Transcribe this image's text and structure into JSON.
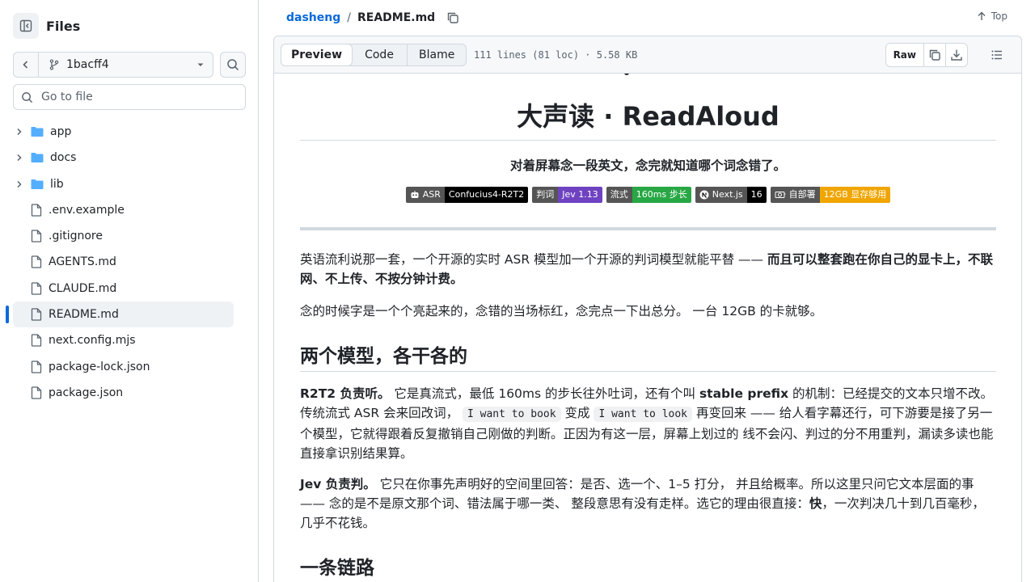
{
  "sidebar": {
    "title": "Files",
    "branch": "1bacff4",
    "goto_placeholder": "Go to file",
    "items": [
      {
        "name": "app",
        "type": "folder"
      },
      {
        "name": "docs",
        "type": "folder"
      },
      {
        "name": "lib",
        "type": "folder"
      },
      {
        "name": ".env.example",
        "type": "file"
      },
      {
        "name": ".gitignore",
        "type": "file"
      },
      {
        "name": "AGENTS.md",
        "type": "file"
      },
      {
        "name": "CLAUDE.md",
        "type": "file"
      },
      {
        "name": "README.md",
        "type": "file",
        "selected": true
      },
      {
        "name": "next.config.mjs",
        "type": "file"
      },
      {
        "name": "package-lock.json",
        "type": "file"
      },
      {
        "name": "package.json",
        "type": "file"
      }
    ]
  },
  "header": {
    "repo": "dasheng",
    "separator": "/",
    "file": "README.md",
    "top_label": "Top"
  },
  "toolbar": {
    "tabs": [
      "Preview",
      "Code",
      "Blame"
    ],
    "file_info": "111 lines (81 loc) · 5.58 KB",
    "raw_label": "Raw"
  },
  "readme": {
    "title": "大声读 · ReadAloud",
    "tagline": "对着屏幕念一段英文，念完就知道哪个词念错了。",
    "badges": [
      {
        "label": "ASR",
        "value": "Confucius4-R2T2",
        "color": "#000000",
        "icon": "robot"
      },
      {
        "label": "判词",
        "value": "Jev 1.13",
        "color": "#6f42c1",
        "icon": ""
      },
      {
        "label": "流式",
        "value": "160ms 步长",
        "color": "#28a745",
        "icon": ""
      },
      {
        "label": "Next.js",
        "value": "16",
        "color": "#000000",
        "icon": "nextjs"
      },
      {
        "label": "自部署",
        "value": "12GB 显存够用",
        "color": "#f0a500",
        "icon": "gpu"
      }
    ],
    "p1": {
      "normal": "英语流利说那一套，一个开源的实时 ASR 模型加一个开源的判词模型就能平替 —— ",
      "bold": "而且可以整套跑在你自己的显卡上，不联网、不上传、不按分钟计费。"
    },
    "p2": "念的时候字是一个个亮起来的，念错的当场标红，念完点一下出总分。 一台 12GB 的卡就够。",
    "h2_models": "两个模型，各干各的",
    "p3": {
      "bold1": "R2T2 负责听。",
      "t1": " 它是真流式，最低 160ms 的步长往外吐词，还有个叫 ",
      "bold2": "stable prefix",
      "t2": " 的机制：已经提交的文本只增不改。传统流式 ASR 会来回改词， ",
      "code1": "I want to book",
      "t3": " 变成 ",
      "code2": "I want to look",
      "t4": " 再变回来 —— 给人看字幕还行，可下游要是接了另一个模型，它就得跟着反复撤销自己刚做的判断。正因为有这一层，屏幕上划过的 线不会闪、判过的分不用重判，漏读多读也能直接拿识别结果算。"
    },
    "p4": {
      "bold1": "Jev 负责判。",
      "t1": " 它只在你事先声明好的空间里回答：是否、选一个、1–5 打分， 并且给概率。所以这里只问它文本层面的事 —— 念的是不是原文那个词、错法属于哪一类、 整段意思有没有走样。选它的理由很直接：",
      "bold2": "快",
      "t2": "，一次判决几十到几百毫秒，几乎不花钱。"
    },
    "h2_pipeline": "一条链路"
  },
  "colors": {
    "accent": "#0969da",
    "border": "#d1d9e0",
    "folder": "#54aeff",
    "text": "#1f2328",
    "muted": "#59636e"
  }
}
